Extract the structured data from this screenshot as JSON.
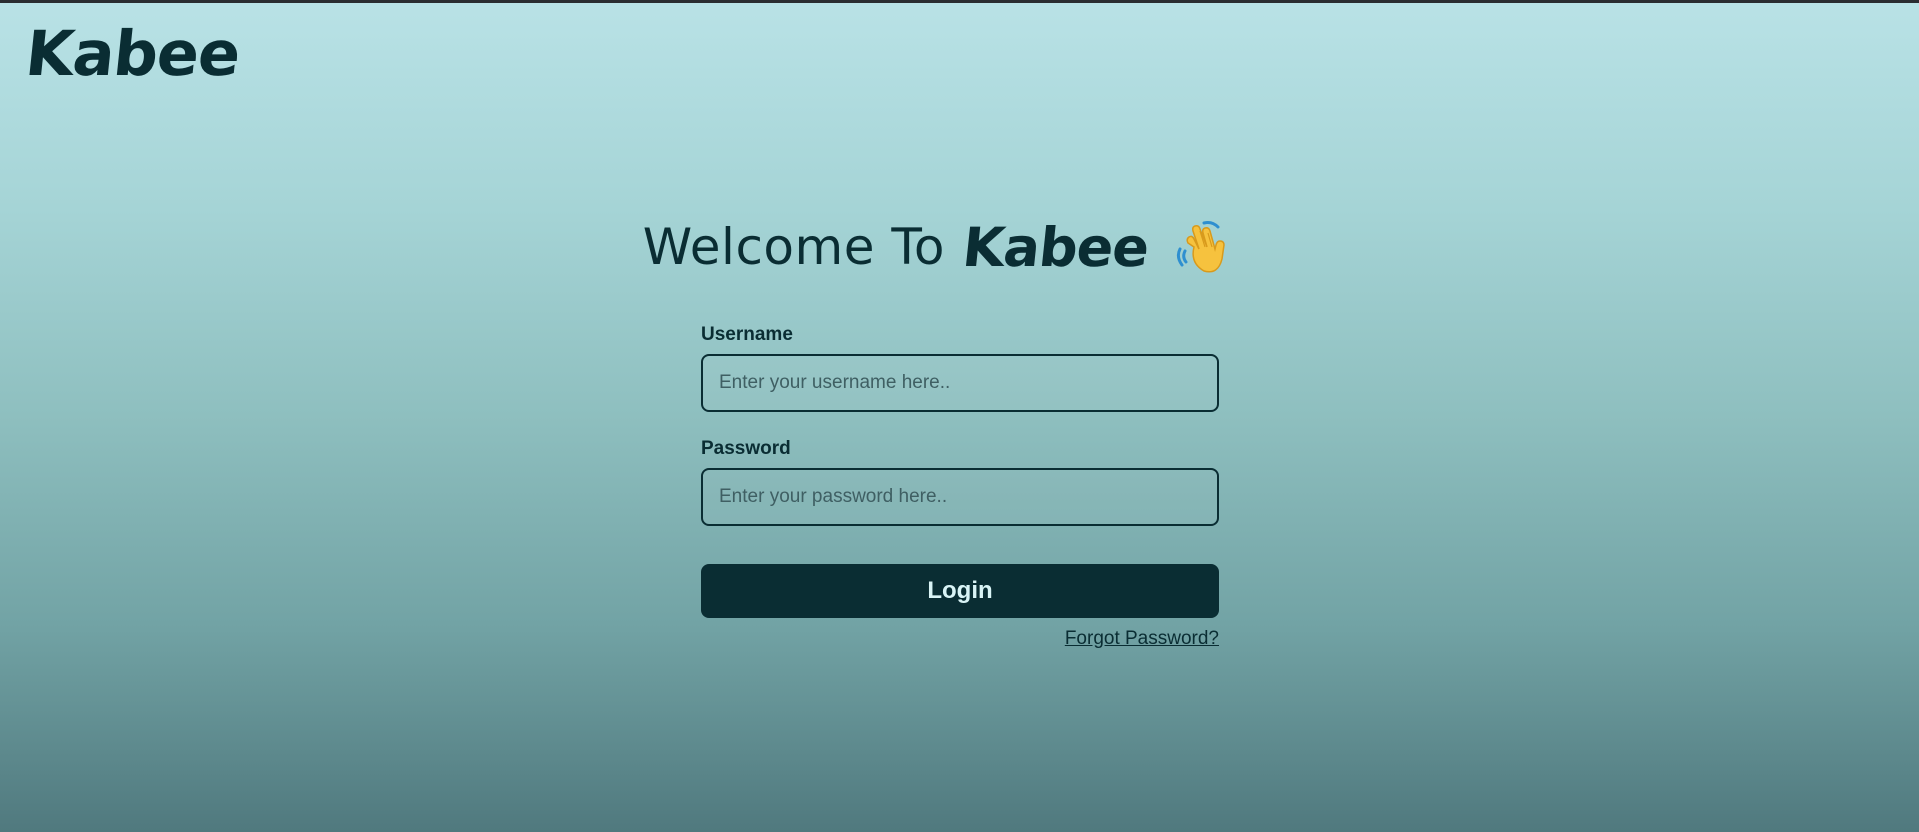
{
  "header": {
    "logo_text": "Kabee"
  },
  "welcome": {
    "text": "Welcome To",
    "brand": "Kabee",
    "icon": "waving-hand-icon"
  },
  "form": {
    "username_label": "Username",
    "username_placeholder": "Enter your username here..",
    "username_value": "",
    "password_label": "Password",
    "password_placeholder": "Enter your password here..",
    "password_value": "",
    "login_label": "Login",
    "forgot_label": "Forgot Password?"
  },
  "colors": {
    "primary": "#0a2d33",
    "button_text": "#d9f4f6",
    "bg_top": "#b9e2e6",
    "bg_bottom": "#50797e"
  }
}
